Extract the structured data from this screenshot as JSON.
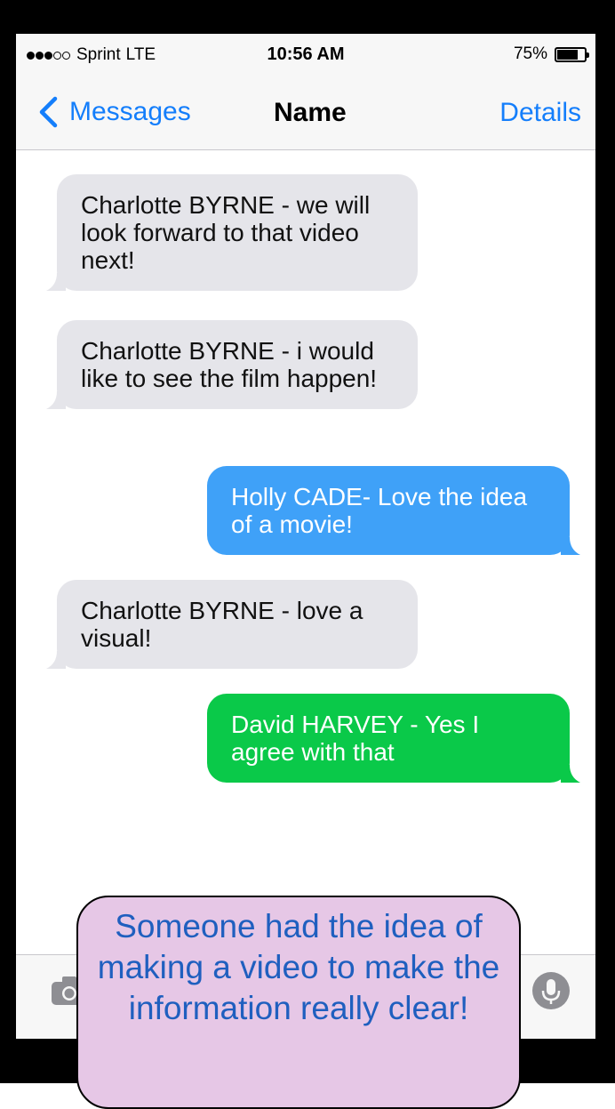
{
  "status_bar": {
    "carrier": "Sprint",
    "network": "LTE",
    "signal_bars_filled": 3,
    "signal_bars_total": 5,
    "time": "10:56 AM",
    "battery_percent": "75%",
    "battery_level": 0.75
  },
  "nav": {
    "back_label": "Messages",
    "title": "Name",
    "action_label": "Details"
  },
  "messages": [
    {
      "direction": "received",
      "text": "Charlotte BYRNE - we will look forward to that video next!"
    },
    {
      "direction": "received",
      "text": "Charlotte BYRNE - i would like to see the film happen!"
    },
    {
      "direction": "sent",
      "color": "#3fa1f8",
      "text": "Holly CADE- Love the idea of a movie!"
    },
    {
      "direction": "received",
      "text": "Charlotte BYRNE - love a visual!"
    },
    {
      "direction": "sent",
      "color": "#0ac949",
      "text": "David HARVEY - Yes I agree with that"
    }
  ],
  "input_bar": {
    "left_icon": "camera-icon",
    "right_icon": "microphone-icon"
  },
  "callout": {
    "text": "Someone had the idea of making a video to make the information really clear!"
  },
  "colors": {
    "ios_blue": "#147efb",
    "received_bubble": "#e5e5ea",
    "callout_fill": "#e6c7e6",
    "callout_text": "#1f5fbf"
  }
}
